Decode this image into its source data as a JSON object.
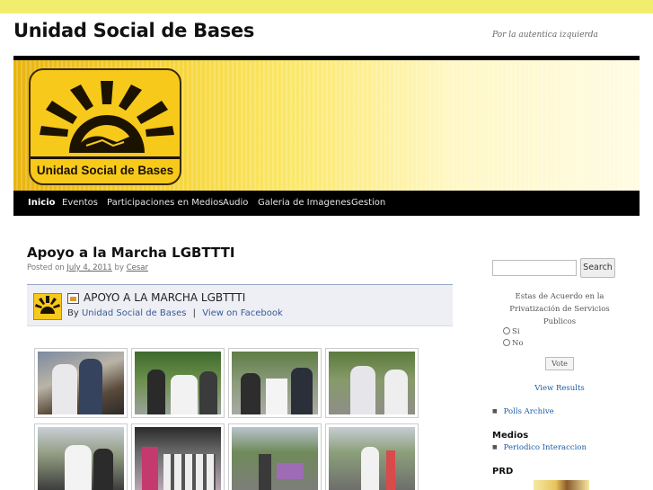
{
  "site": {
    "title": "Unidad Social de Bases",
    "description": "Por la autentica izquierda"
  },
  "banner": {
    "logo_text": "Unidad Social de Bases",
    "colors": {
      "primary": "#f5cf2a",
      "dark": "#1b1200"
    }
  },
  "nav": {
    "items": [
      {
        "label": "Inicio",
        "active": true
      },
      {
        "label": "Eventos"
      },
      {
        "label": "Participaciones en Medios"
      },
      {
        "label": "Audio"
      },
      {
        "label": "Galeria de Imagenes"
      },
      {
        "label": "Gestion"
      }
    ]
  },
  "post": {
    "title": "Apoyo a la Marcha LGBTTTI",
    "meta_prefix": "Posted on",
    "date": "July 4, 2011",
    "by": "by",
    "author": "Cesar"
  },
  "facebook_album": {
    "title": "APOYO A LA MARCHA LGBTTTI",
    "by_label": "By",
    "page_name": "Unidad Social de Bases",
    "separator": "|",
    "view_link": "View on Facebook",
    "thumbnail_count": 8
  },
  "sidebar": {
    "search_button": "Search",
    "poll": {
      "question": "Estas de Acuerdo en la Privatización de Servicios Publicos",
      "options": [
        "Si",
        "No"
      ],
      "vote_button": "Vote",
      "view_results": "View Results",
      "archive_link": "Polls Archive"
    },
    "medios": {
      "title": "Medios",
      "links": [
        "Periodico Interaccion"
      ]
    },
    "prd": {
      "title": "PRD"
    }
  }
}
